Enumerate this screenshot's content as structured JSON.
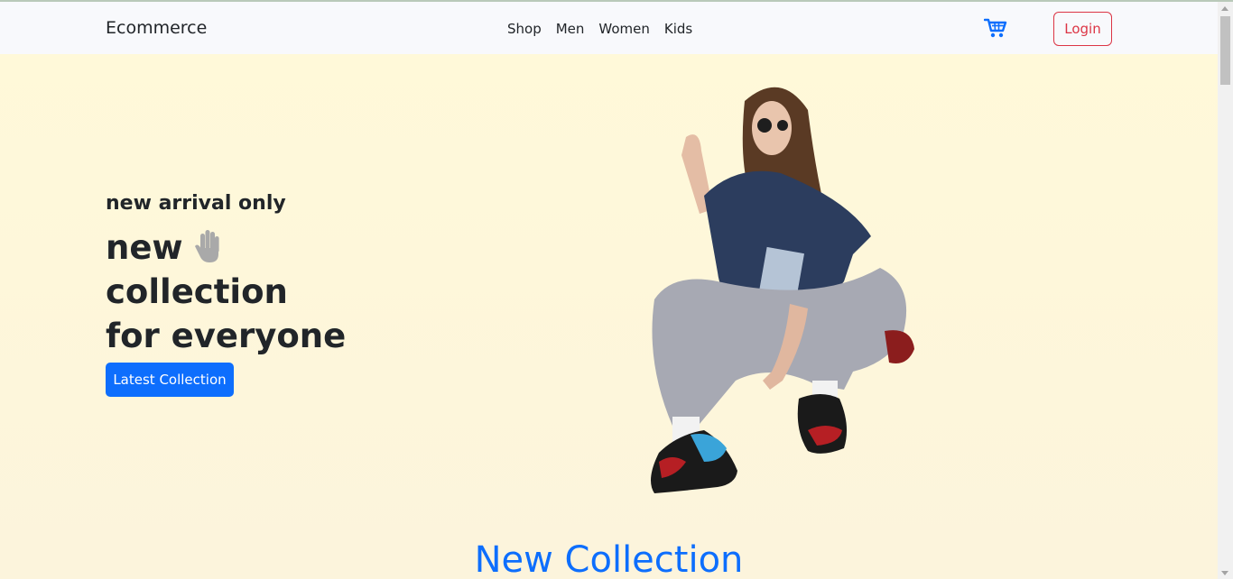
{
  "navbar": {
    "brand": "Ecommerce",
    "links": [
      "Shop",
      "Men",
      "Women",
      "Kids"
    ],
    "cart_icon": "cart-icon",
    "login_label": "Login"
  },
  "hero": {
    "eyebrow": "new arrival only",
    "headline": [
      "new",
      "collection",
      "for everyone"
    ],
    "hand_icon": "waving-hand-icon",
    "cta_label": "Latest Collection",
    "image": "model-photo-sitting-woman-sneakers"
  },
  "section": {
    "title": "New Collection"
  },
  "colors": {
    "primary": "#0d6efd",
    "danger": "#dc3545",
    "hero_bg": "#fff9d9",
    "navbar_bg": "#f8f9fc"
  }
}
